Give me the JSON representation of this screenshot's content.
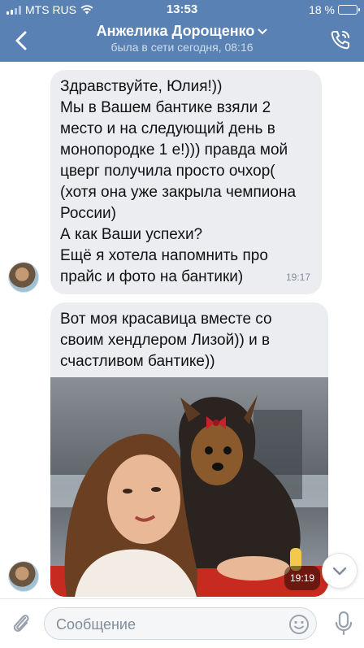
{
  "status_bar": {
    "carrier": "MTS RUS",
    "time": "13:53",
    "battery": "18 %",
    "battery_level": 0.18
  },
  "header": {
    "title": "Анжелика Дорощенко",
    "status": "была в сети сегодня, 08:16"
  },
  "messages": [
    {
      "text": "Здравствуйте, Юлия!))\nМы в Вашем бантике взяли 2 место и на следующий день в монопородке 1 е!))) правда мой цверг получила просто очхор(  (хотя она уже закрыла чемпиона России)\nА как Ваши успехи?\nЕщё я хотела напомнить  про прайс и фото на бантики)",
      "time": "19:17"
    },
    {
      "text": "Вот моя красавица вместе со своим хендлером Лизой)) и в счастливом бантике))",
      "time": "19:19"
    }
  ],
  "composer": {
    "placeholder": "Сообщение"
  },
  "colors": {
    "header_bg": "#5a81b3",
    "bubble_bg": "#ecedf1",
    "accent": "#5181b8"
  }
}
